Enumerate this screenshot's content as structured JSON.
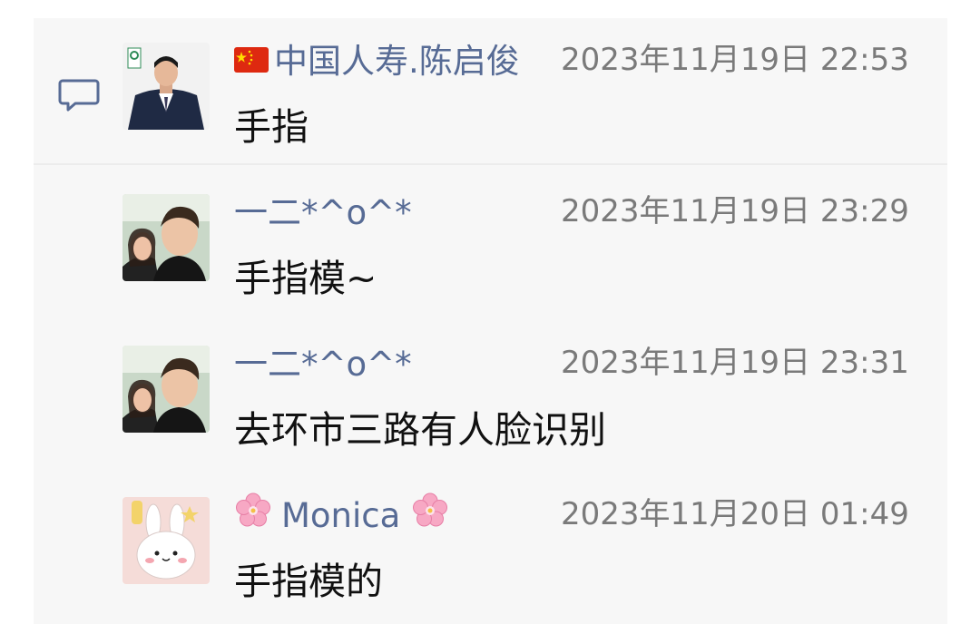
{
  "comments": [
    {
      "name": "中国人寿.陈启俊",
      "name_prefix_icon": "china-flag-icon",
      "time": "2023年11月19日 22:53",
      "text": "手指",
      "avatar": "man-in-suit-avatar"
    },
    {
      "name": "一二*^o^*",
      "time": "2023年11月19日 23:29",
      "text": "手指模~",
      "avatar": "two-people-selfie-avatar"
    },
    {
      "name": "一二*^o^*",
      "time": "2023年11月19日 23:31",
      "text": "去环市三路有人脸识别",
      "avatar": "two-people-selfie-avatar"
    },
    {
      "name": "Monica",
      "name_decoration_icon": "cherry-blossom-icon",
      "time": "2023年11月20日 01:49",
      "text": "手指模的",
      "avatar": "cartoon-bunny-avatar"
    }
  ],
  "colors": {
    "name": "#576b95",
    "time": "#7a7a7a",
    "text": "#111111",
    "panel": "#f7f7f7"
  }
}
